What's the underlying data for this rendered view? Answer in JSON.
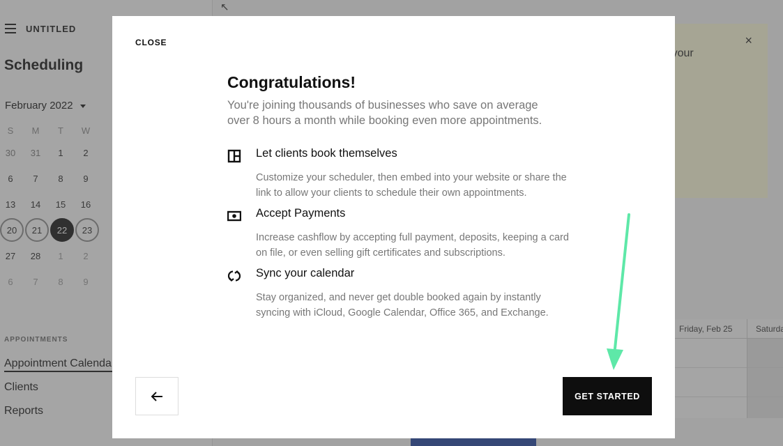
{
  "app": {
    "site_title": "UNTITLED",
    "page_title": "Scheduling",
    "month": "February 2022",
    "weekday_headers": [
      "S",
      "M",
      "T",
      "W"
    ],
    "calendar_rows": [
      [
        "30",
        "31",
        "1",
        "2"
      ],
      [
        "6",
        "7",
        "8",
        "9"
      ],
      [
        "13",
        "14",
        "15",
        "16"
      ],
      [
        "20",
        "21",
        "22",
        "23"
      ],
      [
        "27",
        "28",
        "1",
        "2"
      ],
      [
        "6",
        "7",
        "8",
        "9"
      ]
    ],
    "selected_day": "22",
    "nav_section_label": "APPOINTMENTS",
    "nav_items": [
      {
        "label": "Appointment Calendar",
        "active": true
      },
      {
        "label": "Clients",
        "active": false
      },
      {
        "label": "Reports",
        "active": false
      }
    ],
    "promo_text_fragment": "g up your",
    "week_columns": [
      "Friday, Feb 25",
      "Saturday"
    ]
  },
  "modal": {
    "close_label": "CLOSE",
    "title": "Congratulations!",
    "subtitle": "You're joining thousands of businesses who save on average over 8 hours a month while booking even more appointments.",
    "features": [
      {
        "icon": "layout-icon",
        "title": "Let clients book themselves",
        "description": "Customize your scheduler, then embed into your website or share the link to allow your clients to schedule their own appointments."
      },
      {
        "icon": "payment-icon",
        "title": "Accept Payments",
        "description": "Increase cashflow by accepting full payment, deposits, keeping a card on file, or even selling gift certificates and subscriptions."
      },
      {
        "icon": "sync-icon",
        "title": "Sync your calendar",
        "description": "Stay organized, and never get double booked again by instantly syncing with iCloud, Google Calendar, Office 365, and Exchange."
      }
    ],
    "back_icon": "arrow-left-icon",
    "primary_button": "GET STARTED"
  },
  "annotation": {
    "arrow_color": "#5ee8a8"
  }
}
